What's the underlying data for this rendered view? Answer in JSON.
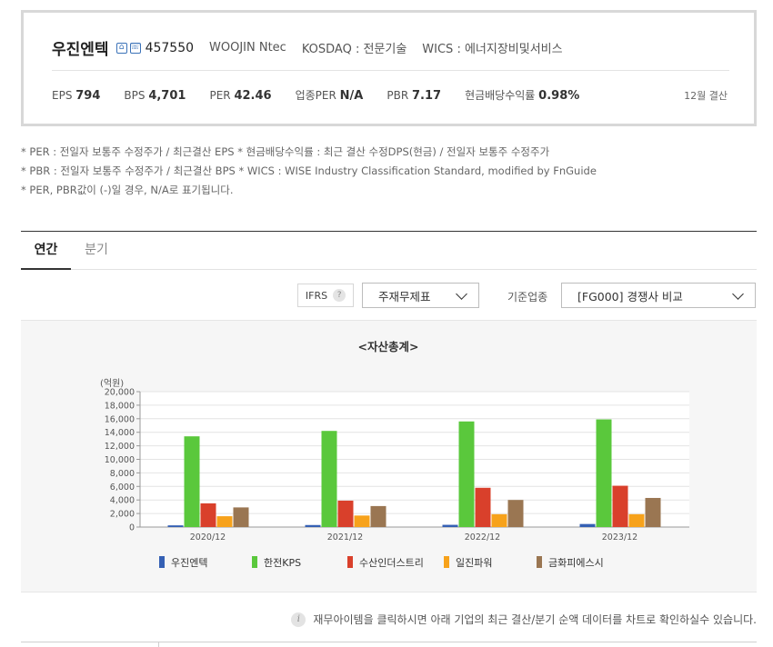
{
  "company": {
    "name": "우진엔텍",
    "code": "457550",
    "english_name": "WOOJIN Ntec",
    "market": "KOSDAQ : 전문기술",
    "wics": "WICS : 에너지장비및서비스"
  },
  "metrics": [
    {
      "label": "EPS",
      "value": "794"
    },
    {
      "label": "BPS",
      "value": "4,701"
    },
    {
      "label": "PER",
      "value": "42.46"
    },
    {
      "label": "업종PER",
      "value": "N/A"
    },
    {
      "label": "PBR",
      "value": "7.17"
    },
    {
      "label": "현금배당수익률",
      "value": "0.98%"
    }
  ],
  "fiscal_note": "12월 결산",
  "footnotes": [
    "* PER : 전일자 보통주 수정주가 / 최근결산 EPS * 현금배당수익률 : 최근 결산 수정DPS(현금) / 전일자 보통주 수정주가",
    "* PBR : 전일자 보통주 수정주가 / 최근결산 BPS * WICS : WISE Industry Classification Standard, modified by FnGuide",
    "* PER, PBR값이 (-)일 경우, N/A로 표기됩니다."
  ],
  "tabs": [
    {
      "label": "연간",
      "active": true
    },
    {
      "label": "분기",
      "active": false
    }
  ],
  "filters": {
    "ifrs_label": "IFRS",
    "help_glyph": "?",
    "statement_select": "주재무제표",
    "industry_label": "기준업종",
    "industry_select": "[FG000] 경쟁사 비교"
  },
  "chart_data": {
    "type": "bar",
    "title": "<자산총계>",
    "ylabel": "(억원)",
    "ylim": [
      0,
      20000
    ],
    "yticks": [
      "0",
      "2,000",
      "4,000",
      "6,000",
      "8,000",
      "10,000",
      "12,000",
      "14,000",
      "16,000",
      "18,000",
      "20,000"
    ],
    "categories": [
      "2020/12",
      "2021/12",
      "2022/12",
      "2023/12"
    ],
    "grid": true,
    "legend_position": "bottom",
    "series": [
      {
        "name": "우진엔텍",
        "color": "#3560b4",
        "values": [
          250,
          300,
          330,
          450
        ]
      },
      {
        "name": "한전KPS",
        "color": "#5ac83c",
        "values": [
          13400,
          14200,
          15600,
          15900
        ]
      },
      {
        "name": "수산인더스트리",
        "color": "#d9402b",
        "values": [
          3500,
          3900,
          5800,
          6100
        ]
      },
      {
        "name": "일진파워",
        "color": "#f7a21b",
        "values": [
          1600,
          1700,
          1900,
          1900
        ]
      },
      {
        "name": "금화피에스시",
        "color": "#9a7652",
        "values": [
          2900,
          3100,
          4000,
          4300
        ]
      }
    ]
  },
  "info_text": "재무아이템을 클릭하시면 아래 기업의 최근 결산/분기 순액 데이터를 차트로 확인하실수 있습니다.",
  "info_glyph": "i"
}
